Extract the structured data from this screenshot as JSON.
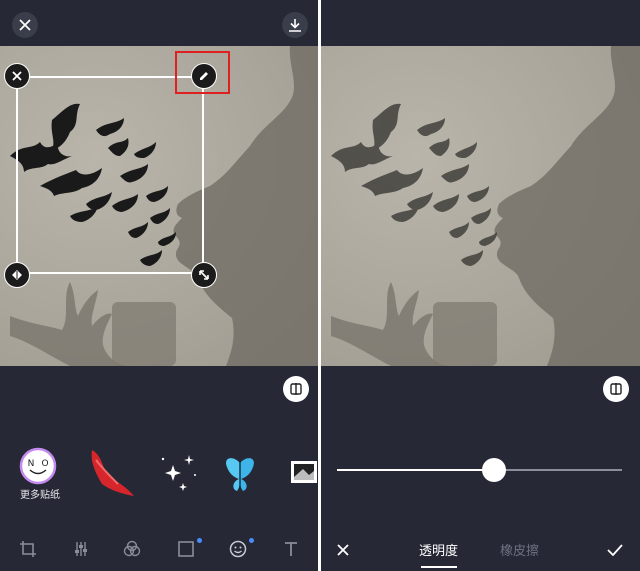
{
  "left_panel": {
    "more_stickers_label": "更多贴纸",
    "logo_letters": {
      "left": "N",
      "right": "O"
    },
    "stickers": [
      {
        "name": "red-feather-sticker"
      },
      {
        "name": "sparkles-sticker"
      },
      {
        "name": "blue-butterfly-sticker"
      },
      {
        "name": "photo-frame-sticker"
      }
    ],
    "tools": [
      {
        "icon": "crop-icon"
      },
      {
        "icon": "adjust-icon"
      },
      {
        "icon": "filter-icon"
      },
      {
        "icon": "frame-icon",
        "badge": true
      },
      {
        "icon": "sticker-icon",
        "badge": true
      },
      {
        "icon": "text-icon"
      }
    ]
  },
  "right_panel": {
    "opacity_slider": {
      "value": 0.55
    },
    "tabs": [
      {
        "label": "透明度",
        "active": true
      },
      {
        "label": "橡皮擦",
        "active": false
      }
    ]
  },
  "colors": {
    "panel_bg": "#262836",
    "accent_badge": "#4a8dff",
    "highlight_frame": "#e02020"
  }
}
